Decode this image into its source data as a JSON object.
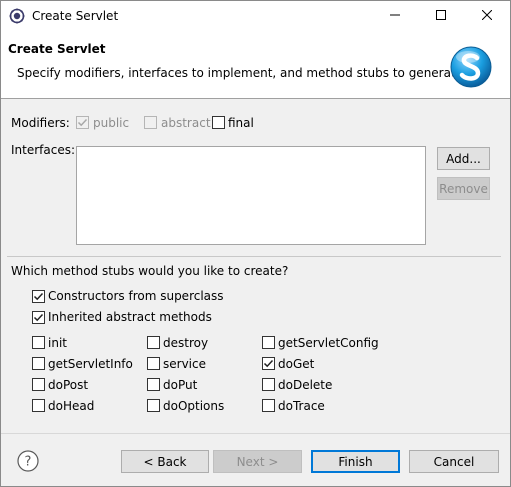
{
  "window": {
    "title": "Create Servlet"
  },
  "header": {
    "title": "Create Servlet",
    "description": "Specify modifiers, interfaces to implement, and method stubs to generate."
  },
  "modifiers": {
    "label": "Modifiers:",
    "public": {
      "label": "public",
      "checked": true,
      "enabled": false
    },
    "abstract": {
      "label": "abstract",
      "checked": false,
      "enabled": false
    },
    "final": {
      "label": "final",
      "checked": false,
      "enabled": true
    }
  },
  "interfaces": {
    "label": "Interfaces:",
    "items": [],
    "add_label": "Add...",
    "remove_label": "Remove"
  },
  "stubs": {
    "question": "Which method stubs would you like to create?",
    "constructors": {
      "label": "Constructors from superclass",
      "checked": true
    },
    "inherited": {
      "label": "Inherited abstract methods",
      "checked": true
    },
    "methods": [
      {
        "label": "init",
        "checked": false
      },
      {
        "label": "destroy",
        "checked": false
      },
      {
        "label": "getServletConfig",
        "checked": false
      },
      {
        "label": "getServletInfo",
        "checked": false
      },
      {
        "label": "service",
        "checked": false
      },
      {
        "label": "doGet",
        "checked": true
      },
      {
        "label": "doPost",
        "checked": false
      },
      {
        "label": "doPut",
        "checked": false
      },
      {
        "label": "doDelete",
        "checked": false
      },
      {
        "label": "doHead",
        "checked": false
      },
      {
        "label": "doOptions",
        "checked": false
      },
      {
        "label": "doTrace",
        "checked": false
      }
    ]
  },
  "footer": {
    "back_label": "< Back",
    "next_label": "Next >",
    "finish_label": "Finish",
    "cancel_label": "Cancel"
  },
  "colors": {
    "accent": "#0078d7",
    "logo": "#1a9ee0"
  },
  "icons": [
    "eclipse-app-icon",
    "minimize-icon",
    "maximize-icon",
    "close-icon",
    "servlet-logo-icon",
    "help-icon",
    "checkmark-icon"
  ]
}
